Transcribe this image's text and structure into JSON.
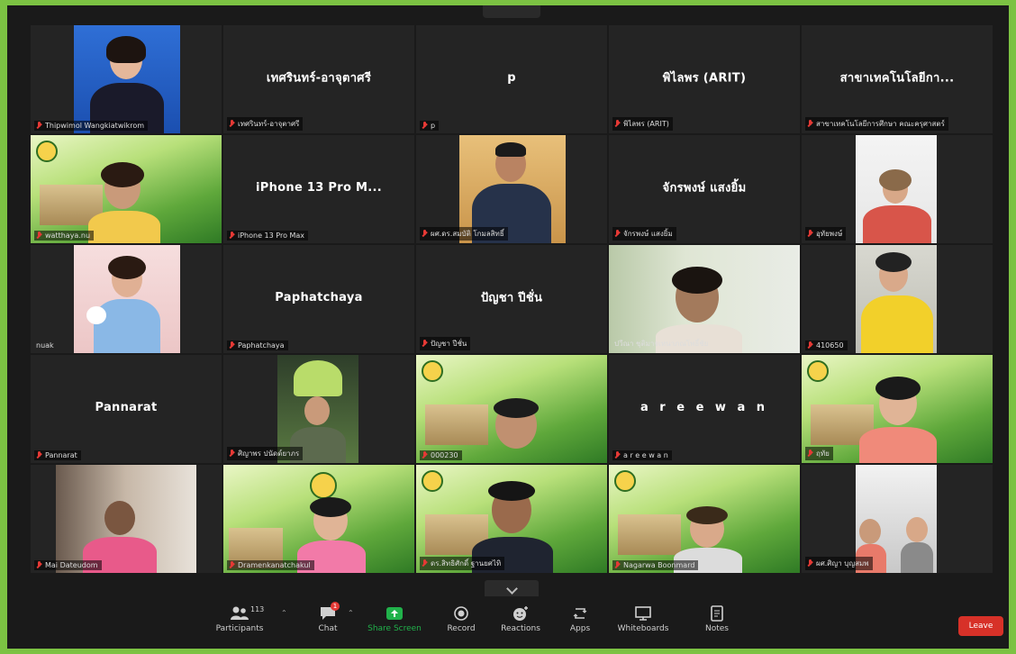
{
  "participants": [
    {
      "name": "Thipwimol Wangkiatwikrom",
      "center": "",
      "mic_muted": true
    },
    {
      "name": "เทศรินทร์-อาจุตาศรี",
      "center": "เทศรินทร์-อาจุตาศรี",
      "mic_muted": true
    },
    {
      "name": "p",
      "center": "p",
      "mic_muted": true
    },
    {
      "name": "พิไลพร (ARIT)",
      "center": "พิไลพร (ARIT)",
      "mic_muted": true
    },
    {
      "name": "สาขาเทคโนโลยีการศึกษา คณะครุศาสตร์",
      "center": "สาขาเทคโนโลยีกา...",
      "mic_muted": true
    },
    {
      "name": "watthaya.nu",
      "center": "",
      "mic_muted": true
    },
    {
      "name": "iPhone 13 Pro Max",
      "center": "iPhone 13 Pro M...",
      "mic_muted": true
    },
    {
      "name": "ผศ.ดร.สมบัติ โกมลสิทธิ์",
      "center": "",
      "mic_muted": true
    },
    {
      "name": "จักรพงษ์ แสงยิ้ม",
      "center": "จักรพงษ์ แสงยิ้ม",
      "mic_muted": true
    },
    {
      "name": "อุทัยพงษ์",
      "center": "",
      "mic_muted": true
    },
    {
      "name": "nuak",
      "center": "",
      "mic_muted": false
    },
    {
      "name": "Paphatchaya",
      "center": "Paphatchaya",
      "mic_muted": true
    },
    {
      "name": "ปัญชา ปีชั่น",
      "center": "ปัญชา ปีชั่น",
      "mic_muted": true
    },
    {
      "name": "ปวีณา ชุติมาจเหนาภณโพธิ์ชัย",
      "center": "",
      "mic_muted": false
    },
    {
      "name": "410650",
      "center": "",
      "mic_muted": true
    },
    {
      "name": "Pannarat",
      "center": "Pannarat",
      "mic_muted": true
    },
    {
      "name": "ศิญาพร ปนัดด์ยาภร",
      "center": "",
      "mic_muted": true
    },
    {
      "name": "000230",
      "center": "",
      "mic_muted": true
    },
    {
      "name": "a r e e w a n",
      "center": "a r e e w a n",
      "mic_muted": true
    },
    {
      "name": "ฤทัย",
      "center": "",
      "mic_muted": true
    },
    {
      "name": "Mai Dateudom",
      "center": "",
      "mic_muted": true
    },
    {
      "name": "Dramenkanatchakul",
      "center": "",
      "mic_muted": true
    },
    {
      "name": "ดร.สิทธิศักดิ์ ฐานยศไทิ",
      "center": "",
      "mic_muted": true
    },
    {
      "name": "Nagarwa Boonmard",
      "center": "",
      "mic_muted": true
    },
    {
      "name": "ผศ.ศิญา บุญสมพ",
      "center": "",
      "mic_muted": true
    }
  ],
  "toolbar": {
    "participants_label": "Participants",
    "participants_count": "113",
    "chat_label": "Chat",
    "chat_badge": "1",
    "share_label": "Share Screen",
    "record_label": "Record",
    "reactions_label": "Reactions",
    "apps_label": "Apps",
    "whiteboards_label": "Whiteboards",
    "notes_label": "Notes",
    "leave_label": "Leave"
  },
  "colors": {
    "frame_border": "#7cc243",
    "leave": "#d73128",
    "share_active": "#21b24b",
    "mic_muted": "#e53935"
  },
  "icons": [
    "participants-icon",
    "chat-icon",
    "share-screen-icon",
    "record-icon",
    "reactions-icon",
    "apps-icon",
    "whiteboard-icon",
    "notes-icon",
    "mic-muted-icon",
    "chevron-down-icon"
  ]
}
